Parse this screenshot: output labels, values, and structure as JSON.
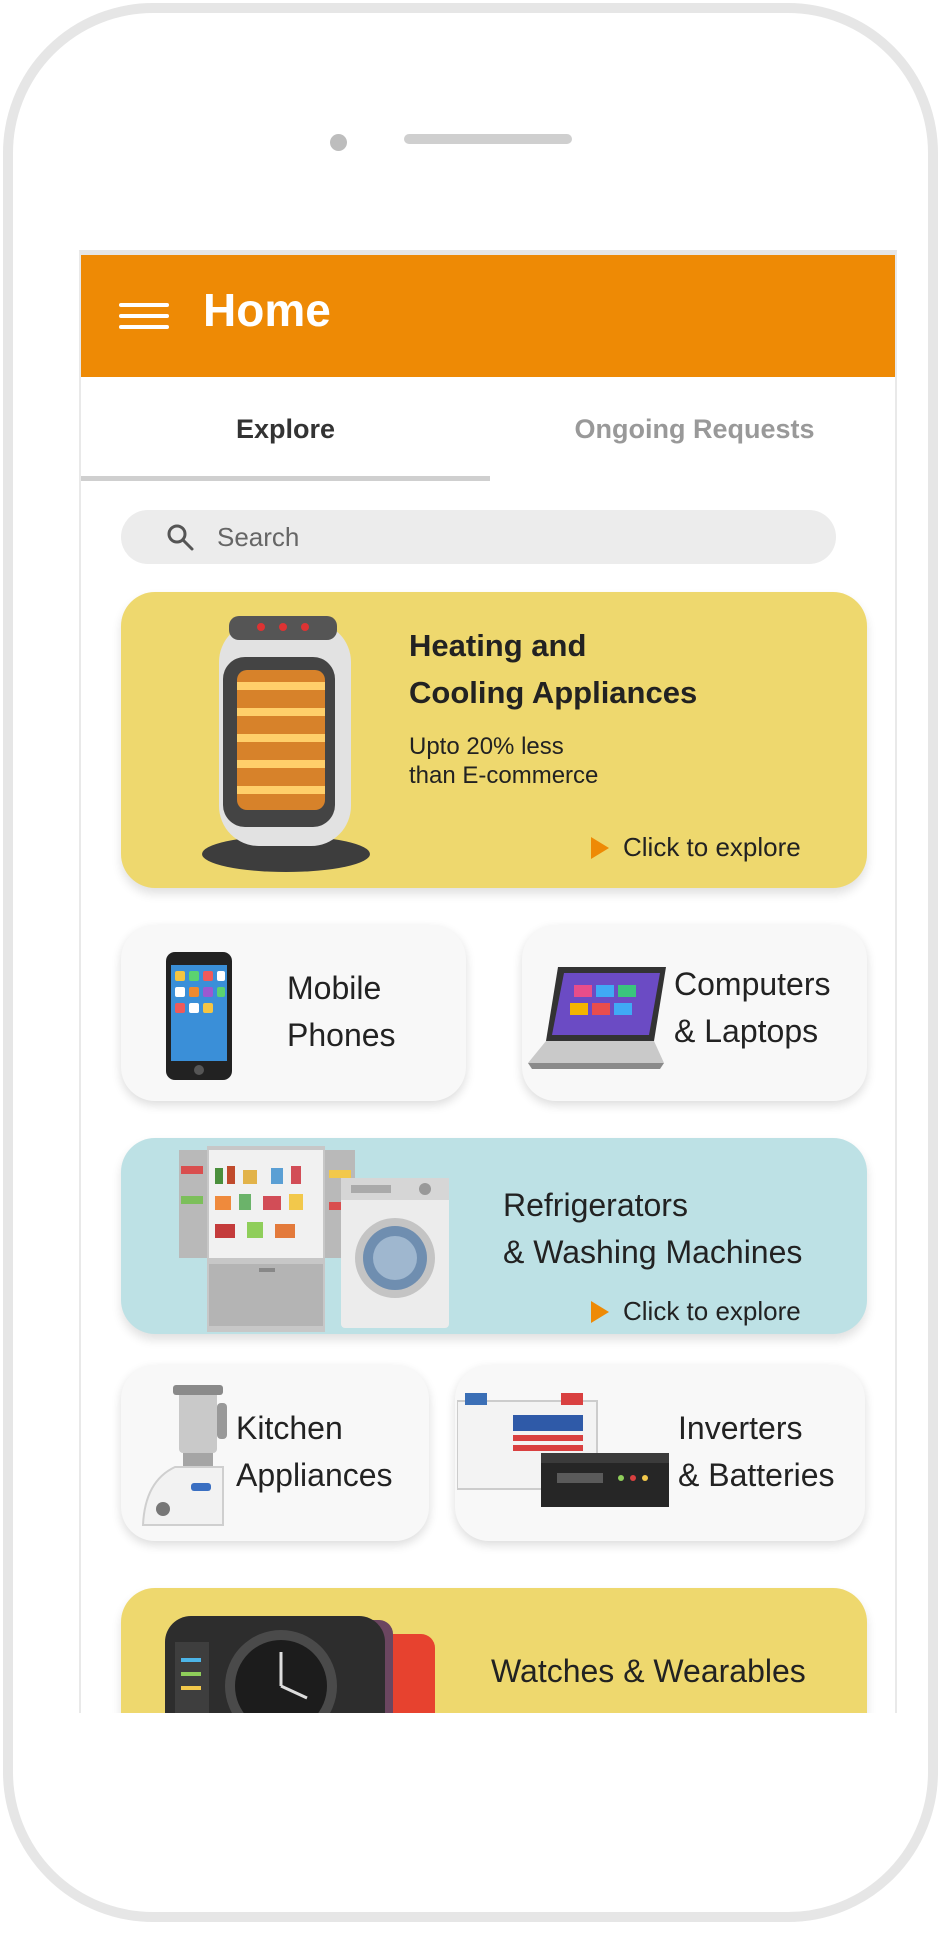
{
  "appbar": {
    "title": "Home"
  },
  "tabs": [
    {
      "label": "Explore"
    },
    {
      "label": "Ongoing Requests"
    }
  ],
  "search": {
    "placeholder": "Search"
  },
  "explore_label": "Click to explore",
  "categories": {
    "heating": {
      "title_line1": "Heating and",
      "title_line2": "Cooling Appliances",
      "subtitle_line1": "Upto 20% less",
      "subtitle_line2": "than E-commerce"
    },
    "mobile": {
      "title_line1": "Mobile",
      "title_line2": "Phones"
    },
    "computers": {
      "title_line1": "Computers",
      "title_line2": "& Laptops"
    },
    "refrigerators": {
      "title_line1": "Refrigerators",
      "title_line2": "& Washing Machines"
    },
    "kitchen": {
      "title_line1": "Kitchen",
      "title_line2": "Appliances"
    },
    "inverters": {
      "title_line1": "Inverters",
      "title_line2": "& Batteries"
    },
    "watches": {
      "title": "Watches & Wearables"
    }
  },
  "colors": {
    "accent": "#ee8a05",
    "yellow_card": "#eed86e",
    "blue_card": "#bde1e5",
    "card_white": "#f8f8f8"
  }
}
